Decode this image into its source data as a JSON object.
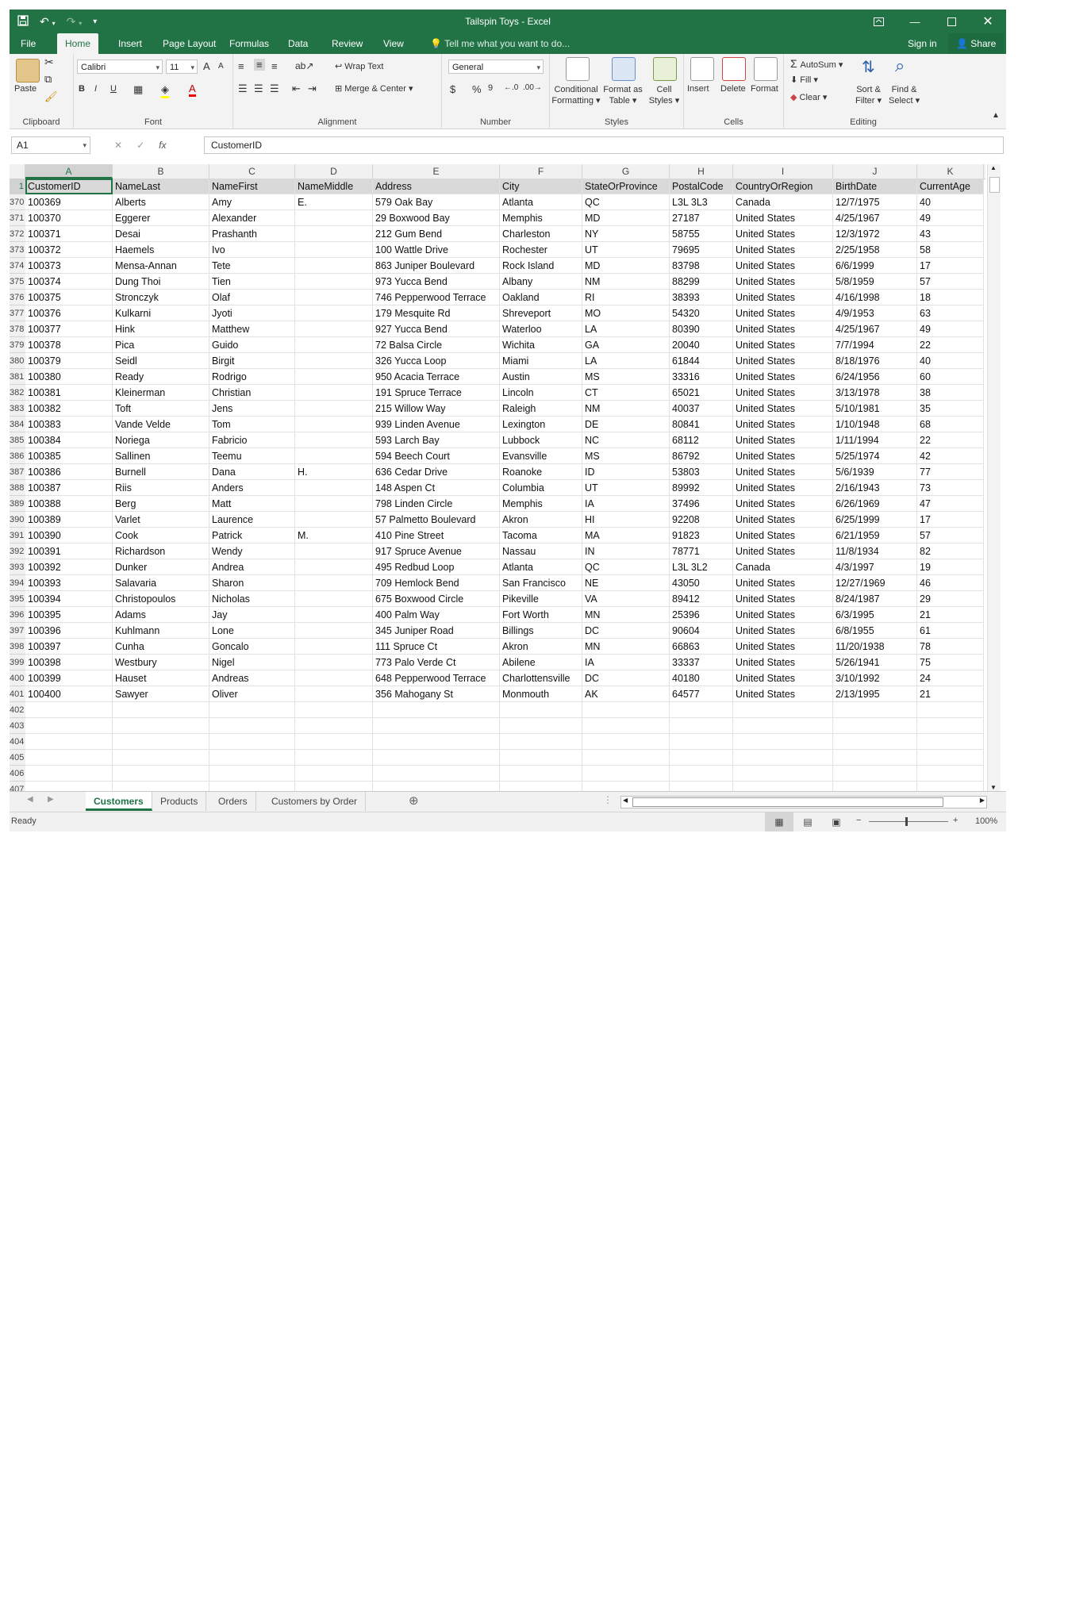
{
  "window": {
    "title": "Tailspin Toys - Excel"
  },
  "tabs": [
    "File",
    "Home",
    "Insert",
    "Page Layout",
    "Formulas",
    "Data",
    "Review",
    "View"
  ],
  "active_tab": "Home",
  "tellme": "Tell me what you want to do...",
  "signin": "Sign in",
  "share": "Share",
  "ribbon": {
    "clipboard": {
      "label": "Clipboard",
      "paste": "Paste"
    },
    "font": {
      "label": "Font",
      "name": "Calibri",
      "size": "11",
      "bold": "B",
      "italic": "I",
      "underline": "U",
      "grow": "A",
      "shrink": "A",
      "font_color": "A"
    },
    "alignment": {
      "label": "Alignment",
      "wrap": "Wrap Text",
      "merge": "Merge & Center"
    },
    "number": {
      "label": "Number",
      "format": "General",
      "currency": "$",
      "percent": "%",
      "comma": "9"
    },
    "styles": {
      "label": "Styles",
      "conditional_1": "Conditional",
      "conditional_2": "Formatting",
      "format_table_1": "Format as",
      "format_table_2": "Table",
      "cell_styles_1": "Cell",
      "cell_styles_2": "Styles"
    },
    "cells": {
      "label": "Cells",
      "insert": "Insert",
      "delete": "Delete",
      "format": "Format"
    },
    "editing": {
      "label": "Editing",
      "autosum": "AutoSum",
      "fill": "Fill",
      "clear": "Clear",
      "sort_1": "Sort &",
      "sort_2": "Filter",
      "find_1": "Find &",
      "find_2": "Select"
    }
  },
  "formula_bar": {
    "name_box": "A1",
    "fx": "fx",
    "content": "CustomerID"
  },
  "columns": [
    "A",
    "B",
    "C",
    "D",
    "E",
    "F",
    "G",
    "H",
    "I",
    "J",
    "K"
  ],
  "header_row": {
    "row": "1",
    "cells": [
      "CustomerID",
      "NameLast",
      "NameFirst",
      "NameMiddle",
      "Address",
      "City",
      "StateOrProvince",
      "PostalCode",
      "CountryOrRegion",
      "BirthDate",
      "CurrentAge"
    ]
  },
  "rows": [
    {
      "row": "370",
      "cells": [
        "100369",
        "Alberts",
        "Amy",
        "E.",
        "579 Oak Bay",
        "Atlanta",
        "QC",
        "L3L 3L3",
        "Canada",
        "12/7/1975",
        "40"
      ]
    },
    {
      "row": "371",
      "cells": [
        "100370",
        "Eggerer",
        "Alexander",
        "",
        "29 Boxwood Bay",
        "Memphis",
        "MD",
        "27187",
        "United States",
        "4/25/1967",
        "49"
      ]
    },
    {
      "row": "372",
      "cells": [
        "100371",
        "Desai",
        "Prashanth",
        "",
        "212 Gum Bend",
        "Charleston",
        "NY",
        "58755",
        "United States",
        "12/3/1972",
        "43"
      ]
    },
    {
      "row": "373",
      "cells": [
        "100372",
        "Haemels",
        "Ivo",
        "",
        "100 Wattle Drive",
        "Rochester",
        "UT",
        "79695",
        "United States",
        "2/25/1958",
        "58"
      ]
    },
    {
      "row": "374",
      "cells": [
        "100373",
        "Mensa-Annan",
        "Tete",
        "",
        "863 Juniper Boulevard",
        "Rock Island",
        "MD",
        "83798",
        "United States",
        "6/6/1999",
        "17"
      ]
    },
    {
      "row": "375",
      "cells": [
        "100374",
        "Dung Thoi",
        "Tien",
        "",
        "973 Yucca Bend",
        "Albany",
        "NM",
        "88299",
        "United States",
        "5/8/1959",
        "57"
      ]
    },
    {
      "row": "376",
      "cells": [
        "100375",
        "Stronczyk",
        "Olaf",
        "",
        "746 Pepperwood Terrace",
        "Oakland",
        "RI",
        "38393",
        "United States",
        "4/16/1998",
        "18"
      ]
    },
    {
      "row": "377",
      "cells": [
        "100376",
        "Kulkarni",
        "Jyoti",
        "",
        "179 Mesquite Rd",
        "Shreveport",
        "MO",
        "54320",
        "United States",
        "4/9/1953",
        "63"
      ]
    },
    {
      "row": "378",
      "cells": [
        "100377",
        "Hink",
        "Matthew",
        "",
        "927 Yucca Bend",
        "Waterloo",
        "LA",
        "80390",
        "United States",
        "4/25/1967",
        "49"
      ]
    },
    {
      "row": "379",
      "cells": [
        "100378",
        "Pica",
        "Guido",
        "",
        "72 Balsa Circle",
        "Wichita",
        "GA",
        "20040",
        "United States",
        "7/7/1994",
        "22"
      ]
    },
    {
      "row": "380",
      "cells": [
        "100379",
        "Seidl",
        "Birgit",
        "",
        "326 Yucca Loop",
        "Miami",
        "LA",
        "61844",
        "United States",
        "8/18/1976",
        "40"
      ]
    },
    {
      "row": "381",
      "cells": [
        "100380",
        "Ready",
        "Rodrigo",
        "",
        "950 Acacia Terrace",
        "Austin",
        "MS",
        "33316",
        "United States",
        "6/24/1956",
        "60"
      ]
    },
    {
      "row": "382",
      "cells": [
        "100381",
        "Kleinerman",
        "Christian",
        "",
        "191 Spruce Terrace",
        "Lincoln",
        "CT",
        "65021",
        "United States",
        "3/13/1978",
        "38"
      ]
    },
    {
      "row": "383",
      "cells": [
        "100382",
        "Toft",
        "Jens",
        "",
        "215 Willow Way",
        "Raleigh",
        "NM",
        "40037",
        "United States",
        "5/10/1981",
        "35"
      ]
    },
    {
      "row": "384",
      "cells": [
        "100383",
        "Vande Velde",
        "Tom",
        "",
        "939 Linden Avenue",
        "Lexington",
        "DE",
        "80841",
        "United States",
        "1/10/1948",
        "68"
      ]
    },
    {
      "row": "385",
      "cells": [
        "100384",
        "Noriega",
        "Fabricio",
        "",
        "593 Larch Bay",
        "Lubbock",
        "NC",
        "68112",
        "United States",
        "1/11/1994",
        "22"
      ]
    },
    {
      "row": "386",
      "cells": [
        "100385",
        "Sallinen",
        "Teemu",
        "",
        "594 Beech Court",
        "Evansville",
        "MS",
        "86792",
        "United States",
        "5/25/1974",
        "42"
      ]
    },
    {
      "row": "387",
      "cells": [
        "100386",
        "Burnell",
        "Dana",
        "H.",
        "636 Cedar Drive",
        "Roanoke",
        "ID",
        "53803",
        "United States",
        "5/6/1939",
        "77"
      ]
    },
    {
      "row": "388",
      "cells": [
        "100387",
        "Riis",
        "Anders",
        "",
        "148 Aspen Ct",
        "Columbia",
        "UT",
        "89992",
        "United States",
        "2/16/1943",
        "73"
      ]
    },
    {
      "row": "389",
      "cells": [
        "100388",
        "Berg",
        "Matt",
        "",
        "798 Linden Circle",
        "Memphis",
        "IA",
        "37496",
        "United States",
        "6/26/1969",
        "47"
      ]
    },
    {
      "row": "390",
      "cells": [
        "100389",
        "Varlet",
        "Laurence",
        "",
        "57 Palmetto Boulevard",
        "Akron",
        "HI",
        "92208",
        "United States",
        "6/25/1999",
        "17"
      ]
    },
    {
      "row": "391",
      "cells": [
        "100390",
        "Cook",
        "Patrick",
        "M.",
        "410 Pine Street",
        "Tacoma",
        "MA",
        "91823",
        "United States",
        "6/21/1959",
        "57"
      ]
    },
    {
      "row": "392",
      "cells": [
        "100391",
        "Richardson",
        "Wendy",
        "",
        "917 Spruce Avenue",
        "Nassau",
        "IN",
        "78771",
        "United States",
        "11/8/1934",
        "82"
      ]
    },
    {
      "row": "393",
      "cells": [
        "100392",
        "Dunker",
        "Andrea",
        "",
        "495 Redbud Loop",
        "Atlanta",
        "QC",
        "L3L 3L2",
        "Canada",
        "4/3/1997",
        "19"
      ]
    },
    {
      "row": "394",
      "cells": [
        "100393",
        "Salavaria",
        "Sharon",
        "",
        "709 Hemlock Bend",
        "San Francisco",
        "NE",
        "43050",
        "United States",
        "12/27/1969",
        "46"
      ]
    },
    {
      "row": "395",
      "cells": [
        "100394",
        "Christopoulos",
        "Nicholas",
        "",
        "675 Boxwood Circle",
        "Pikeville",
        "VA",
        "89412",
        "United States",
        "8/24/1987",
        "29"
      ]
    },
    {
      "row": "396",
      "cells": [
        "100395",
        "Adams",
        "Jay",
        "",
        "400 Palm Way",
        "Fort Worth",
        "MN",
        "25396",
        "United States",
        "6/3/1995",
        "21"
      ]
    },
    {
      "row": "397",
      "cells": [
        "100396",
        "Kuhlmann",
        "Lone",
        "",
        "345 Juniper Road",
        "Billings",
        "DC",
        "90604",
        "United States",
        "6/8/1955",
        "61"
      ]
    },
    {
      "row": "398",
      "cells": [
        "100397",
        "Cunha",
        "Goncalo",
        "",
        "111 Spruce Ct",
        "Akron",
        "MN",
        "66863",
        "United States",
        "11/20/1938",
        "78"
      ]
    },
    {
      "row": "399",
      "cells": [
        "100398",
        "Westbury",
        "Nigel",
        "",
        "773 Palo Verde Ct",
        "Abilene",
        "IA",
        "33337",
        "United States",
        "5/26/1941",
        "75"
      ]
    },
    {
      "row": "400",
      "cells": [
        "100399",
        "Hauset",
        "Andreas",
        "",
        "648 Pepperwood Terrace",
        "Charlottensville",
        "DC",
        "40180",
        "United States",
        "3/10/1992",
        "24"
      ]
    },
    {
      "row": "401",
      "cells": [
        "100400",
        "Sawyer",
        "Oliver",
        "",
        "356 Mahogany St",
        "Monmouth",
        "AK",
        "64577",
        "United States",
        "2/13/1995",
        "21"
      ]
    },
    {
      "row": "402",
      "cells": [
        "",
        "",
        "",
        "",
        "",
        "",
        "",
        "",
        "",
        "",
        ""
      ]
    },
    {
      "row": "403",
      "cells": [
        "",
        "",
        "",
        "",
        "",
        "",
        "",
        "",
        "",
        "",
        ""
      ]
    },
    {
      "row": "404",
      "cells": [
        "",
        "",
        "",
        "",
        "",
        "",
        "",
        "",
        "",
        "",
        ""
      ]
    },
    {
      "row": "405",
      "cells": [
        "",
        "",
        "",
        "",
        "",
        "",
        "",
        "",
        "",
        "",
        ""
      ]
    },
    {
      "row": "406",
      "cells": [
        "",
        "",
        "",
        "",
        "",
        "",
        "",
        "",
        "",
        "",
        ""
      ]
    },
    {
      "row": "407",
      "cells": [
        "",
        "",
        "",
        "",
        "",
        "",
        "",
        "",
        "",
        "",
        ""
      ]
    }
  ],
  "sheets": [
    "Customers",
    "Products",
    "Orders",
    "Customers by Order"
  ],
  "active_sheet": "Customers",
  "status": {
    "ready": "Ready",
    "zoom": "100%"
  },
  "colors": {
    "accent": "#217346"
  }
}
